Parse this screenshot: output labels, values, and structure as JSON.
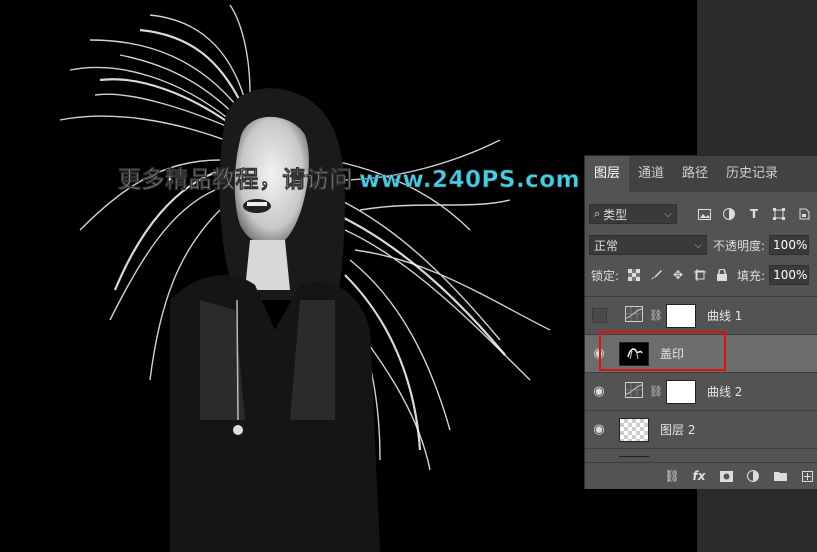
{
  "watermark": {
    "text": "更多精品教程，请访问",
    "url": "www.240PS.com"
  },
  "layers_panel": {
    "tabs": [
      {
        "label": "图层",
        "active": true
      },
      {
        "label": "通道"
      },
      {
        "label": "路径"
      },
      {
        "label": "历史记录"
      }
    ],
    "filter": {
      "kind_label": "类型",
      "icons": [
        "image-filter-icon",
        "adjustment-filter-icon",
        "type-filter-icon",
        "shape-filter-icon",
        "smart-object-filter-icon"
      ]
    },
    "blend_mode": "正常",
    "opacity_label": "不透明度:",
    "opacity_value": "100%",
    "lock_label": "锁定:",
    "fill_label": "填充:",
    "fill_value": "100%",
    "layers": [
      {
        "name": "曲线 1",
        "visible": false,
        "type": "adjustment"
      },
      {
        "name": "盖印",
        "visible": true,
        "type": "pixel",
        "selected": true
      },
      {
        "name": "曲线 2",
        "visible": true,
        "type": "adjustment"
      },
      {
        "name": "图层 2",
        "visible": true,
        "type": "pixel"
      }
    ],
    "bottom_icons": [
      "link-layers-icon",
      "fx-icon",
      "add-mask-icon",
      "adjustment-layer-icon",
      "new-group-icon",
      "new-layer-icon"
    ]
  }
}
